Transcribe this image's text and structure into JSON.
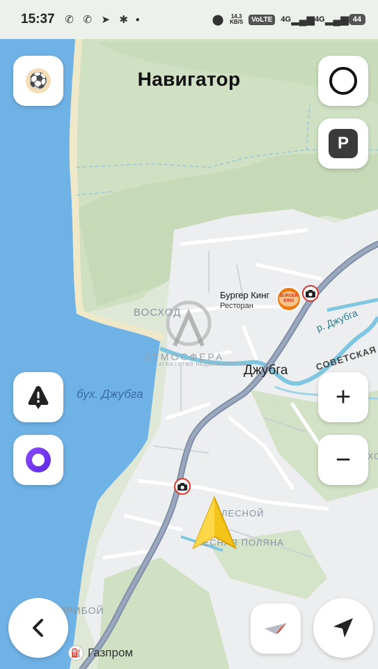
{
  "status_bar": {
    "time": "15:37",
    "network_speed_value": "14,3",
    "network_speed_unit": "KB/S",
    "volte": "VoLTE",
    "sim1": "4G",
    "sim2": "4G",
    "battery": "44"
  },
  "header": {
    "title": "Навигатор"
  },
  "map": {
    "poi": {
      "name": "Бургер Кинг",
      "category": "Ресторан",
      "logo_top": "BURGER",
      "logo_bottom": "KING"
    },
    "town_label": "Джубга",
    "bay_label": "бух. Джубга",
    "river_label": "р. Джубга",
    "street_label": "СОВЕТСКАЯ",
    "districts": [
      "ВОСХОД",
      "ЛЕСНОЙ",
      "ЛЕСНАЯ ПОЛЯНА",
      "ПРИБОЙ",
      "ОРЕХОВ"
    ],
    "watermark": {
      "name": "АТМОСФЕРА",
      "tagline": "АГЕНТСТВО НЕДВИЖИМОСТИ"
    },
    "gas_station": "Газпром"
  },
  "controls": {
    "zoom_in": "+",
    "zoom_out": "−",
    "parking": "P",
    "back": "‹"
  }
}
